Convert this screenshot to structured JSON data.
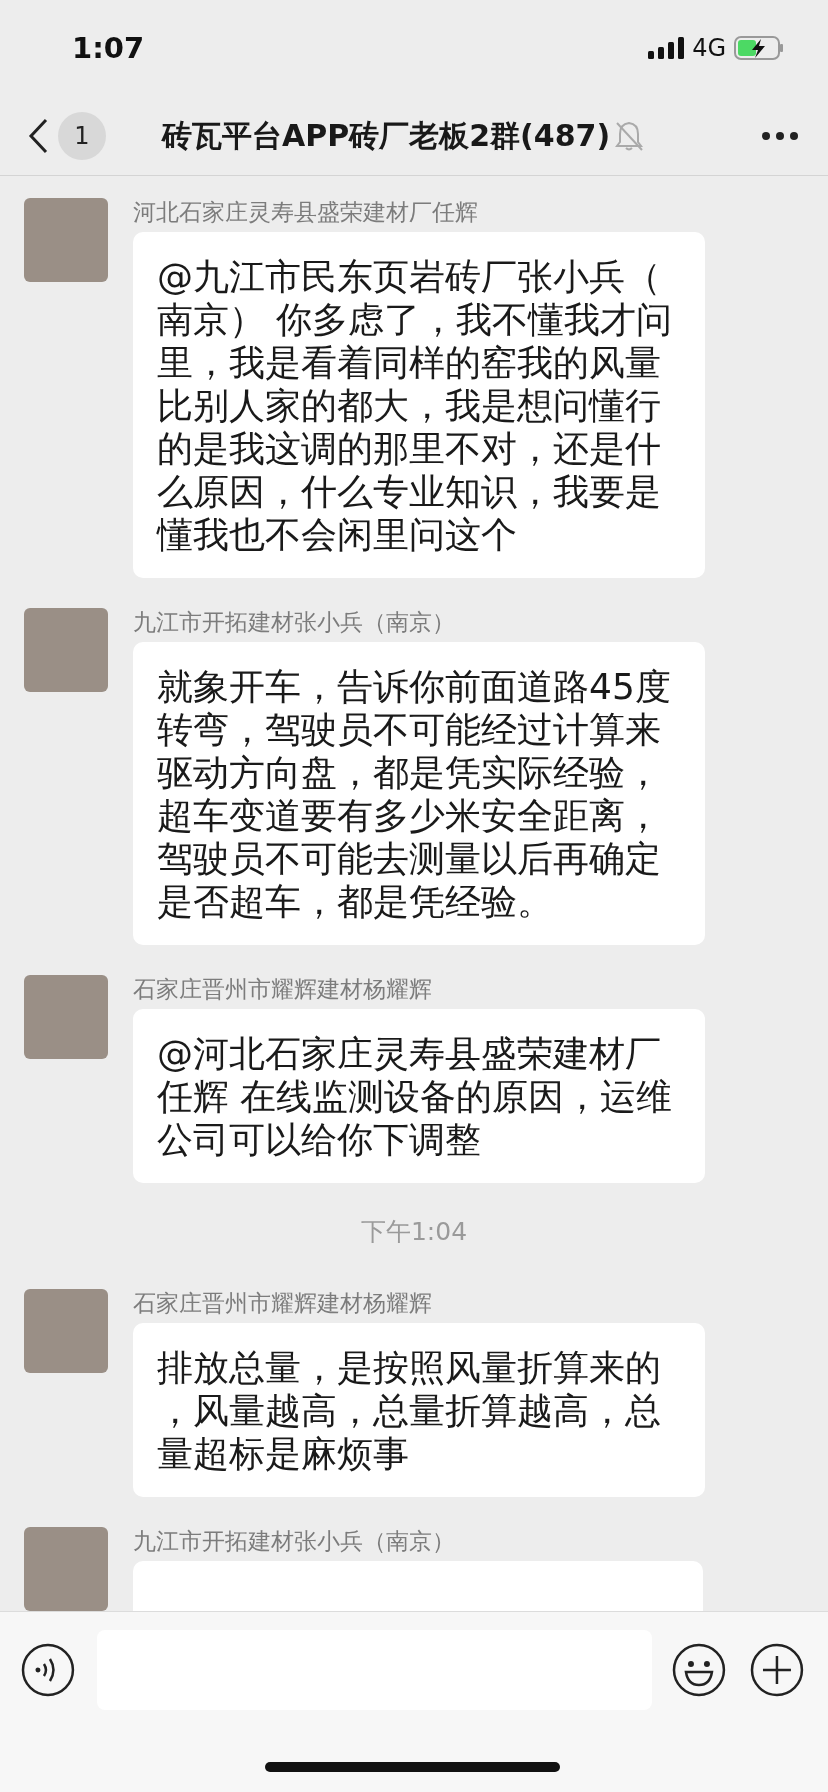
{
  "status_bar": {
    "time": "1:07",
    "network": "4G"
  },
  "header": {
    "back_badge": "1",
    "title": "砖瓦平台APP砖厂老板2群(487)",
    "muted": true
  },
  "messages": [
    {
      "kind": "message",
      "sender": "河北石家庄灵寿县盛荣建材厂任辉",
      "text": "@九江市民东页岩砖厂张小兵（南京） 你多虑了，我不懂我才问里，我是看着同样的窑我的风量比别人家的都大，我是想问懂行的是我这调的那里不对，还是什么原因，什么专业知识，我要是懂我也不会闲里问这个"
    },
    {
      "kind": "message",
      "sender": "九江市开拓建材张小兵（南京）",
      "text": "就象开车，告诉你前面道路45度转弯，驾驶员不可能经过计算来驱动方向盘，都是凭实际经验，超车变道要有多少米安全距离，驾驶员不可能去测量以后再确定是否超车，都是凭经验。"
    },
    {
      "kind": "message",
      "sender": "石家庄晋州市耀辉建材杨耀辉",
      "text": "@河北石家庄灵寿县盛荣建材厂任辉 在线监测设备的原因，运维公司可以给你下调整"
    },
    {
      "kind": "time",
      "text": "下午1:04"
    },
    {
      "kind": "message",
      "sender": "石家庄晋州市耀辉建材杨耀辉",
      "text": "排放总量，是按照风量折算来的，风量越高，总量折算越高，总量超标是麻烦事"
    },
    {
      "kind": "message",
      "sender": "九江市开拓建材张小兵（南京）"
    }
  ]
}
